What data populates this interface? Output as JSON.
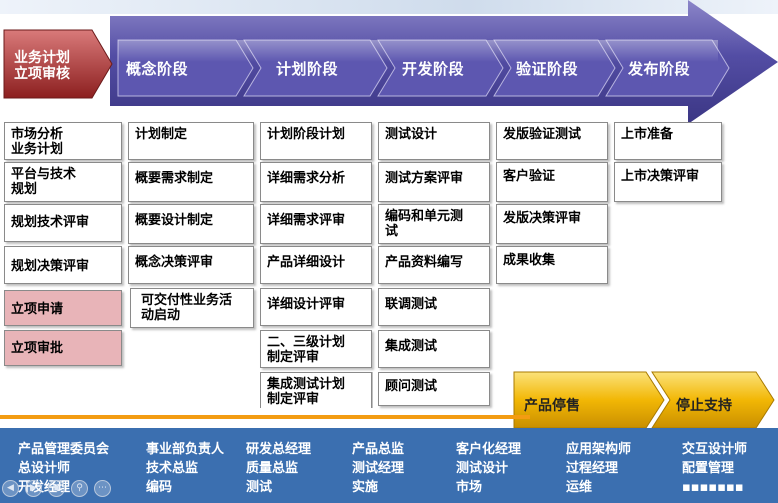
{
  "review": {
    "line1": "业务计划",
    "line2": "立项审核"
  },
  "phases": [
    "概念阶段",
    "计划阶段",
    "开发阶段",
    "验证阶段",
    "发布阶段"
  ],
  "columns": {
    "business": [
      "市场分析\n业务计划",
      "平台与技术\n规划",
      "规划技术评审",
      "规划决策评审",
      "立项申请",
      "立项审批"
    ],
    "concept": [
      "计划制定",
      "概要需求制定",
      "概要设计制定",
      "概念决策评审",
      "可交付性业务活\n动启动"
    ],
    "plan": [
      "计划阶段计划",
      "详细需求分析",
      "详细需求评审",
      "产品详细设计",
      "详细设计评审",
      "二、三级计划\n制定评审",
      "集成测试计划\n制定评审"
    ],
    "develop": [
      "测试设计",
      "测试方案评审",
      "编码和单元测\n试",
      "产品资料编写",
      "联调测试",
      "集成测试",
      "顾问测试"
    ],
    "verify": [
      "发版验证测试",
      "客户验证",
      "发版决策评审",
      "成果收集"
    ],
    "release": [
      "上市准备",
      "上市决策评审"
    ]
  },
  "lifecycle_end": [
    "产品停售",
    "停止支持"
  ],
  "roles": [
    [
      "产品管理委员会",
      "总设计师",
      "开发经理"
    ],
    [
      "事业部负责人",
      "技术总监",
      "编码"
    ],
    [
      "研发总经理",
      "质量总监",
      "测试"
    ],
    [
      "产品总监",
      "测试经理",
      "实施"
    ],
    [
      "客户化经理",
      "测试设计",
      "市场"
    ],
    [
      "应用架构师",
      "过程经理",
      "运维"
    ],
    [
      "交互设计师",
      "配置管理",
      "▪▪▪▪▪▪▪"
    ]
  ],
  "colors": {
    "phase_arrow": "#4f4aa0",
    "review_arrow": "#a83232",
    "stop_arrow": "#f2b705",
    "roles_bg": "#3b6fb0",
    "pink_box": "#e8b4b8"
  }
}
